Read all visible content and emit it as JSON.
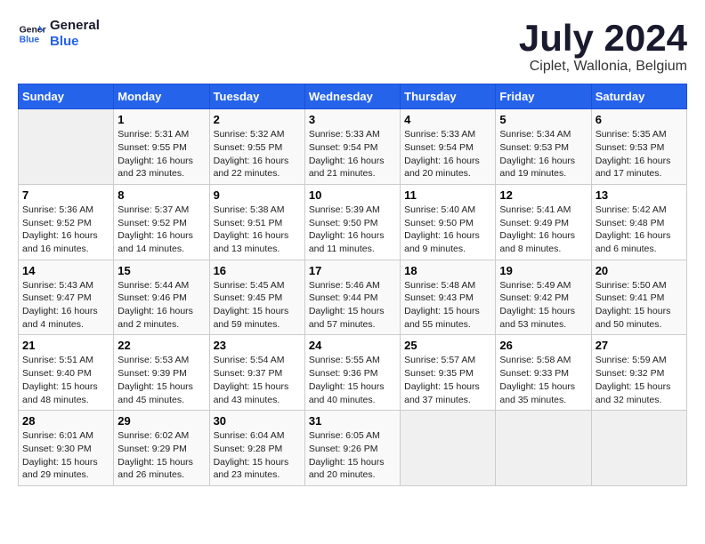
{
  "header": {
    "logo_line1": "General",
    "logo_line2": "Blue",
    "month_title": "July 2024",
    "location": "Ciplet, Wallonia, Belgium"
  },
  "weekdays": [
    "Sunday",
    "Monday",
    "Tuesday",
    "Wednesday",
    "Thursday",
    "Friday",
    "Saturday"
  ],
  "weeks": [
    [
      {
        "day": "",
        "sunrise": "",
        "sunset": "",
        "daylight": ""
      },
      {
        "day": "1",
        "sunrise": "Sunrise: 5:31 AM",
        "sunset": "Sunset: 9:55 PM",
        "daylight": "Daylight: 16 hours and 23 minutes."
      },
      {
        "day": "2",
        "sunrise": "Sunrise: 5:32 AM",
        "sunset": "Sunset: 9:55 PM",
        "daylight": "Daylight: 16 hours and 22 minutes."
      },
      {
        "day": "3",
        "sunrise": "Sunrise: 5:33 AM",
        "sunset": "Sunset: 9:54 PM",
        "daylight": "Daylight: 16 hours and 21 minutes."
      },
      {
        "day": "4",
        "sunrise": "Sunrise: 5:33 AM",
        "sunset": "Sunset: 9:54 PM",
        "daylight": "Daylight: 16 hours and 20 minutes."
      },
      {
        "day": "5",
        "sunrise": "Sunrise: 5:34 AM",
        "sunset": "Sunset: 9:53 PM",
        "daylight": "Daylight: 16 hours and 19 minutes."
      },
      {
        "day": "6",
        "sunrise": "Sunrise: 5:35 AM",
        "sunset": "Sunset: 9:53 PM",
        "daylight": "Daylight: 16 hours and 17 minutes."
      }
    ],
    [
      {
        "day": "7",
        "sunrise": "Sunrise: 5:36 AM",
        "sunset": "Sunset: 9:52 PM",
        "daylight": "Daylight: 16 hours and 16 minutes."
      },
      {
        "day": "8",
        "sunrise": "Sunrise: 5:37 AM",
        "sunset": "Sunset: 9:52 PM",
        "daylight": "Daylight: 16 hours and 14 minutes."
      },
      {
        "day": "9",
        "sunrise": "Sunrise: 5:38 AM",
        "sunset": "Sunset: 9:51 PM",
        "daylight": "Daylight: 16 hours and 13 minutes."
      },
      {
        "day": "10",
        "sunrise": "Sunrise: 5:39 AM",
        "sunset": "Sunset: 9:50 PM",
        "daylight": "Daylight: 16 hours and 11 minutes."
      },
      {
        "day": "11",
        "sunrise": "Sunrise: 5:40 AM",
        "sunset": "Sunset: 9:50 PM",
        "daylight": "Daylight: 16 hours and 9 minutes."
      },
      {
        "day": "12",
        "sunrise": "Sunrise: 5:41 AM",
        "sunset": "Sunset: 9:49 PM",
        "daylight": "Daylight: 16 hours and 8 minutes."
      },
      {
        "day": "13",
        "sunrise": "Sunrise: 5:42 AM",
        "sunset": "Sunset: 9:48 PM",
        "daylight": "Daylight: 16 hours and 6 minutes."
      }
    ],
    [
      {
        "day": "14",
        "sunrise": "Sunrise: 5:43 AM",
        "sunset": "Sunset: 9:47 PM",
        "daylight": "Daylight: 16 hours and 4 minutes."
      },
      {
        "day": "15",
        "sunrise": "Sunrise: 5:44 AM",
        "sunset": "Sunset: 9:46 PM",
        "daylight": "Daylight: 16 hours and 2 minutes."
      },
      {
        "day": "16",
        "sunrise": "Sunrise: 5:45 AM",
        "sunset": "Sunset: 9:45 PM",
        "daylight": "Daylight: 15 hours and 59 minutes."
      },
      {
        "day": "17",
        "sunrise": "Sunrise: 5:46 AM",
        "sunset": "Sunset: 9:44 PM",
        "daylight": "Daylight: 15 hours and 57 minutes."
      },
      {
        "day": "18",
        "sunrise": "Sunrise: 5:48 AM",
        "sunset": "Sunset: 9:43 PM",
        "daylight": "Daylight: 15 hours and 55 minutes."
      },
      {
        "day": "19",
        "sunrise": "Sunrise: 5:49 AM",
        "sunset": "Sunset: 9:42 PM",
        "daylight": "Daylight: 15 hours and 53 minutes."
      },
      {
        "day": "20",
        "sunrise": "Sunrise: 5:50 AM",
        "sunset": "Sunset: 9:41 PM",
        "daylight": "Daylight: 15 hours and 50 minutes."
      }
    ],
    [
      {
        "day": "21",
        "sunrise": "Sunrise: 5:51 AM",
        "sunset": "Sunset: 9:40 PM",
        "daylight": "Daylight: 15 hours and 48 minutes."
      },
      {
        "day": "22",
        "sunrise": "Sunrise: 5:53 AM",
        "sunset": "Sunset: 9:39 PM",
        "daylight": "Daylight: 15 hours and 45 minutes."
      },
      {
        "day": "23",
        "sunrise": "Sunrise: 5:54 AM",
        "sunset": "Sunset: 9:37 PM",
        "daylight": "Daylight: 15 hours and 43 minutes."
      },
      {
        "day": "24",
        "sunrise": "Sunrise: 5:55 AM",
        "sunset": "Sunset: 9:36 PM",
        "daylight": "Daylight: 15 hours and 40 minutes."
      },
      {
        "day": "25",
        "sunrise": "Sunrise: 5:57 AM",
        "sunset": "Sunset: 9:35 PM",
        "daylight": "Daylight: 15 hours and 37 minutes."
      },
      {
        "day": "26",
        "sunrise": "Sunrise: 5:58 AM",
        "sunset": "Sunset: 9:33 PM",
        "daylight": "Daylight: 15 hours and 35 minutes."
      },
      {
        "day": "27",
        "sunrise": "Sunrise: 5:59 AM",
        "sunset": "Sunset: 9:32 PM",
        "daylight": "Daylight: 15 hours and 32 minutes."
      }
    ],
    [
      {
        "day": "28",
        "sunrise": "Sunrise: 6:01 AM",
        "sunset": "Sunset: 9:30 PM",
        "daylight": "Daylight: 15 hours and 29 minutes."
      },
      {
        "day": "29",
        "sunrise": "Sunrise: 6:02 AM",
        "sunset": "Sunset: 9:29 PM",
        "daylight": "Daylight: 15 hours and 26 minutes."
      },
      {
        "day": "30",
        "sunrise": "Sunrise: 6:04 AM",
        "sunset": "Sunset: 9:28 PM",
        "daylight": "Daylight: 15 hours and 23 minutes."
      },
      {
        "day": "31",
        "sunrise": "Sunrise: 6:05 AM",
        "sunset": "Sunset: 9:26 PM",
        "daylight": "Daylight: 15 hours and 20 minutes."
      },
      {
        "day": "",
        "sunrise": "",
        "sunset": "",
        "daylight": ""
      },
      {
        "day": "",
        "sunrise": "",
        "sunset": "",
        "daylight": ""
      },
      {
        "day": "",
        "sunrise": "",
        "sunset": "",
        "daylight": ""
      }
    ]
  ]
}
